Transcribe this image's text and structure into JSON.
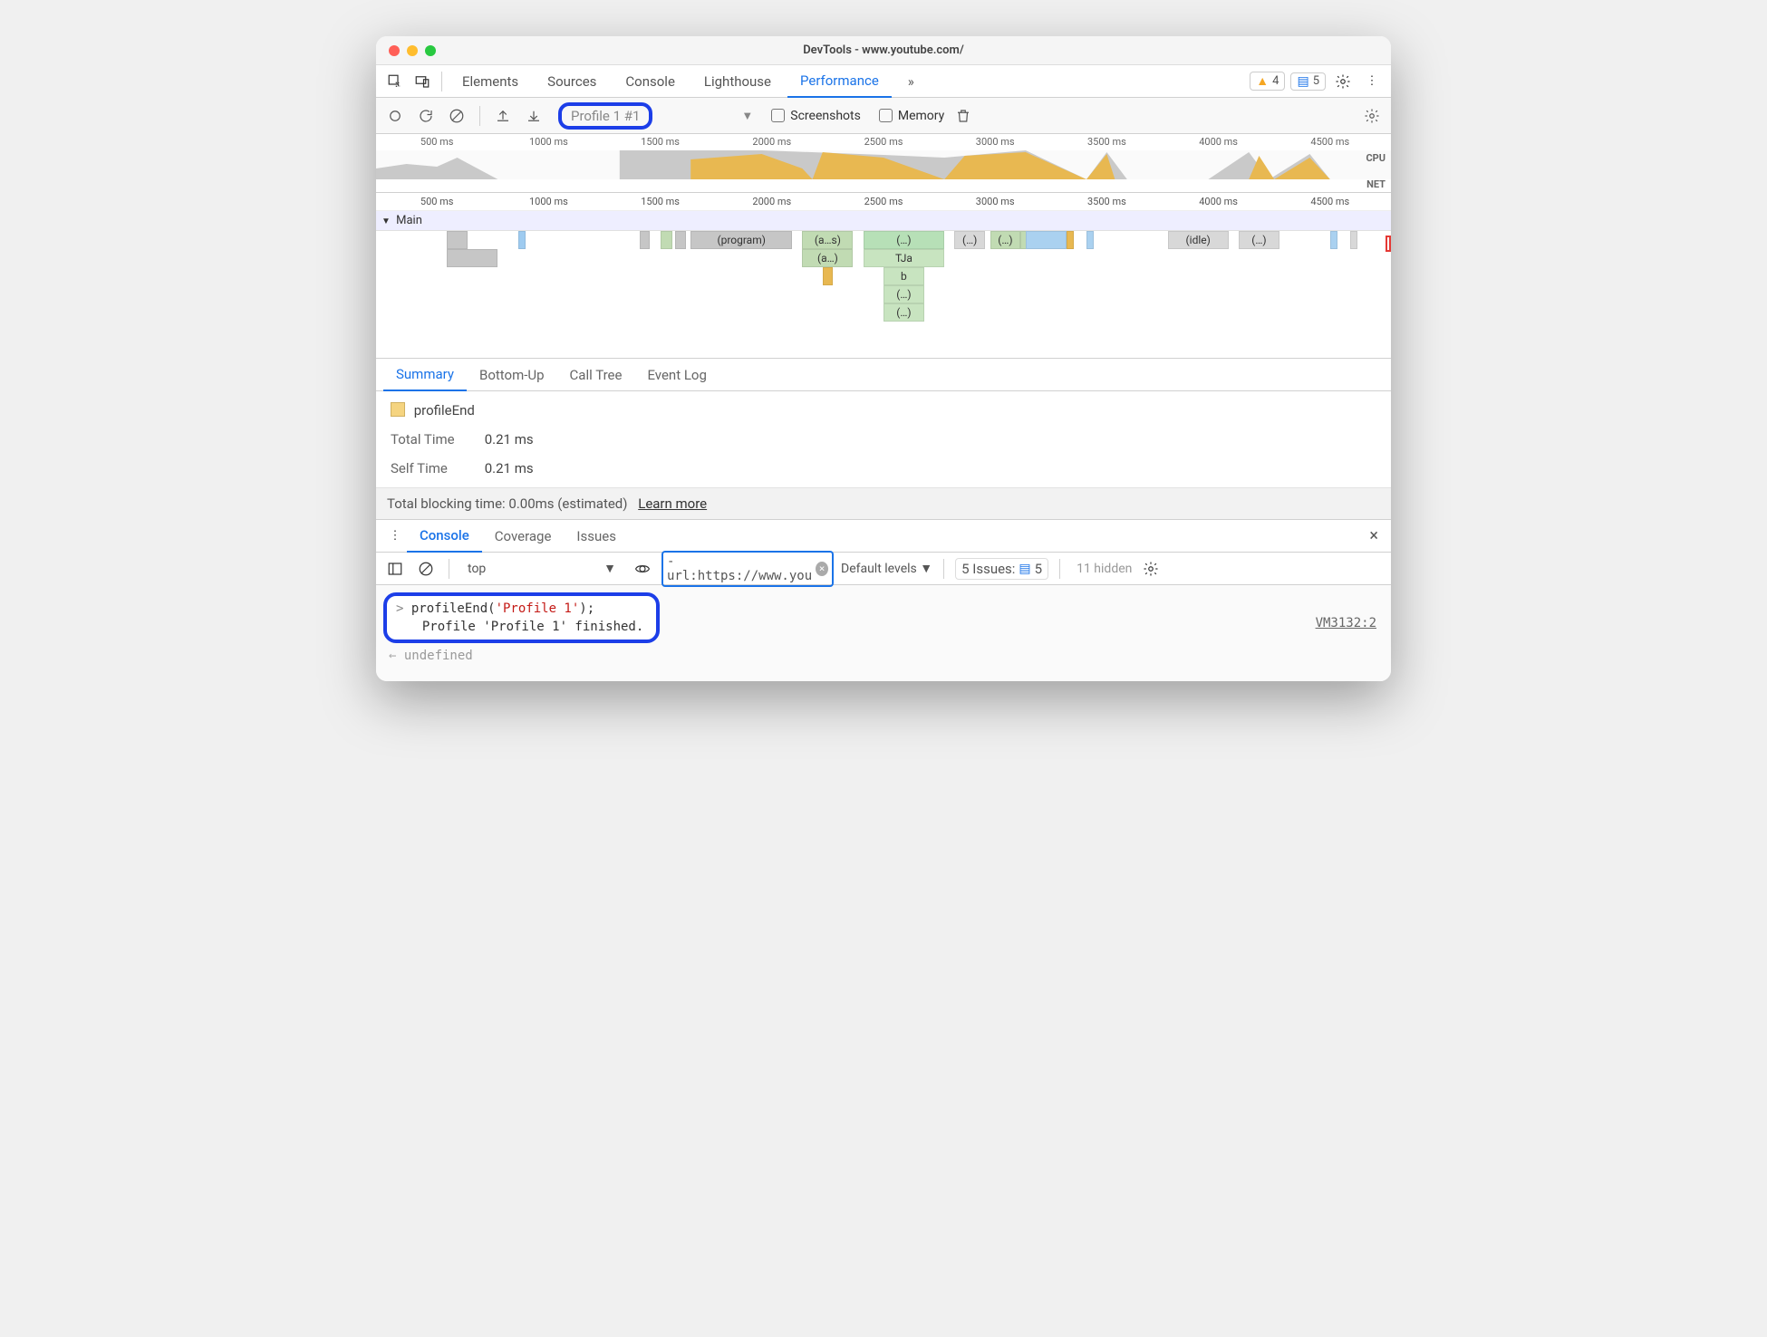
{
  "window_title": "DevTools - www.youtube.com/",
  "tabs": [
    "Elements",
    "Sources",
    "Console",
    "Lighthouse",
    "Performance"
  ],
  "active_tab": "Performance",
  "warn_count": "4",
  "info_count": "5",
  "profile_name": "Profile 1 #1",
  "checkbox_screenshots": "Screenshots",
  "checkbox_memory": "Memory",
  "ruler_marks": [
    "500 ms",
    "1000 ms",
    "1500 ms",
    "2000 ms",
    "2500 ms",
    "3000 ms",
    "3500 ms",
    "4000 ms",
    "4500 ms"
  ],
  "cpu_label": "CPU",
  "net_label": "NET",
  "main_track_label": "Main",
  "flame_labels": {
    "program": "(program)",
    "as": "(a…s)",
    "dots": "(…)",
    "a": "(a…)",
    "tja": "TJa",
    "b": "b",
    "idle": "(idle)"
  },
  "detail_tabs": [
    "Summary",
    "Bottom-Up",
    "Call Tree",
    "Event Log"
  ],
  "active_detail_tab": "Summary",
  "summary_name": "profileEnd",
  "summary_total_lbl": "Total Time",
  "summary_total_val": "0.21 ms",
  "summary_self_lbl": "Self Time",
  "summary_self_val": "0.21 ms",
  "tbt_text": "Total blocking time: 0.00ms (estimated)",
  "tbt_link": "Learn more",
  "drawer_tabs": [
    "Console",
    "Coverage",
    "Issues"
  ],
  "active_drawer_tab": "Console",
  "console_context": "top",
  "console_filter": "-url:https://www.you",
  "console_levels": "Default levels",
  "console_issues_label": "5 Issues:",
  "console_issues_count": "5",
  "console_hidden": "11 hidden",
  "console_input_text": "profileEnd(",
  "console_input_arg": "'Profile 1'",
  "console_input_tail": ");",
  "console_output_text": "Profile 'Profile 1' finished.",
  "console_source": "VM3132:2",
  "console_undefined": "undefined"
}
